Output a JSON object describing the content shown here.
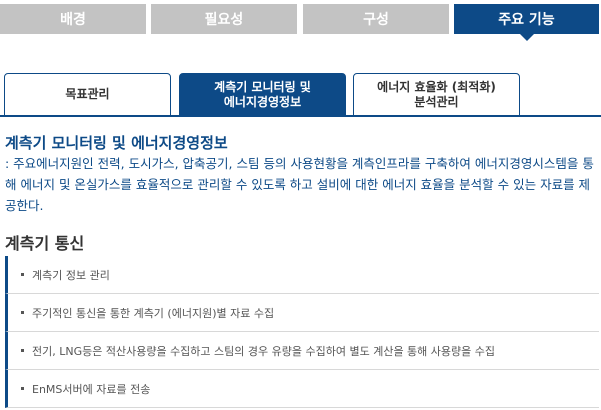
{
  "top_tabs": [
    {
      "label": "배경",
      "active": false
    },
    {
      "label": "필요성",
      "active": false
    },
    {
      "label": "구성",
      "active": false
    },
    {
      "label": "주요 기능",
      "active": true
    }
  ],
  "sub_tabs": [
    {
      "label": "목표관리",
      "active": false
    },
    {
      "label": "계측기 모니터링 및\n에너지경영정보",
      "active": true
    },
    {
      "label": "에너지 효율화 (최적화)\n분석관리",
      "active": false
    }
  ],
  "section": {
    "title": "계측기 모니터링 및 에너지경영정보",
    "description": ": 주요에너지원인 전력, 도시가스, 압축공기, 스팀 등의 사용현황을 계측인프라를 구축하여 에너지경영시스템을 통해 에너지 및 온실가스를 효율적으로 관리할 수 있도록 하고 설비에 대한 에너지 효율을 분석할 수 있는 자료를 제공한다."
  },
  "subsection": {
    "title": "계측기 통신",
    "items": [
      "계측기 정보 관리",
      "주기적인 통신을 통한 계측기 (에너지원)별 자료 수집",
      "전기, LNG등은 적산사용량을 수집하고 스팀의 경우 유량을 수집하여 별도 계산을 통해 사용량을 수집",
      "EnMS서버에 자료를 전송"
    ]
  },
  "colors": {
    "accent": "#0d4a87",
    "inactive_tab": "#c3c3c3"
  }
}
